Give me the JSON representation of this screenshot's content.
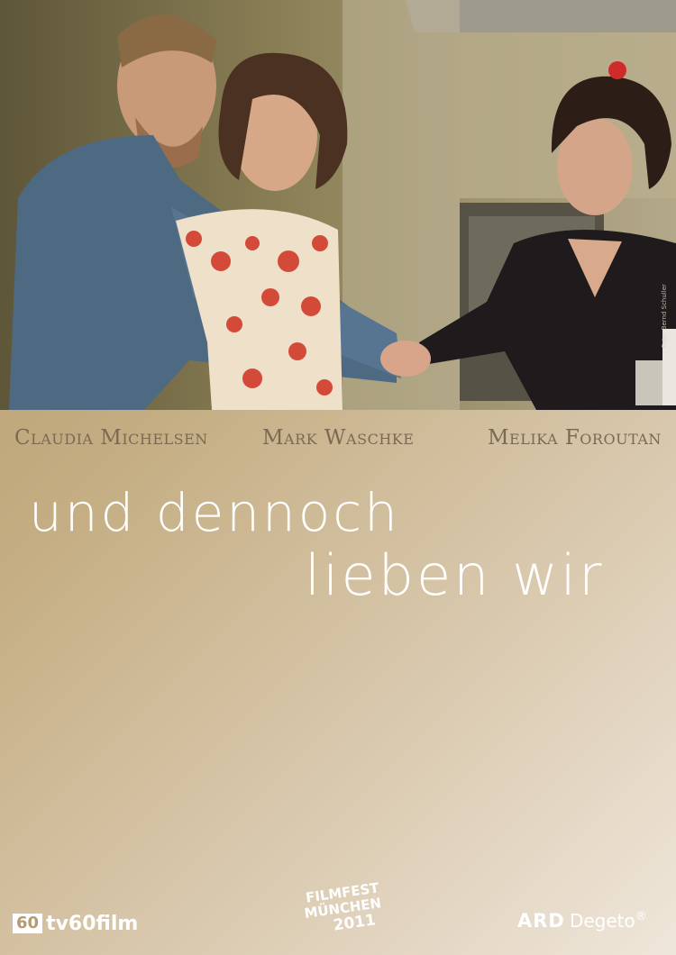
{
  "cast": {
    "actor1": "Claudia Michelsen",
    "actor2": "Mark Waschke",
    "actor3": "Melika Foroutan"
  },
  "title": {
    "line1": "und dennoch",
    "line2": "lieben wir"
  },
  "photo": {
    "credit": "Foto: Bernd Schuller"
  },
  "logos": {
    "tv60_badge": "60",
    "tv60_name": "tv60film",
    "filmfest_line1": "FILMFEST",
    "filmfest_line2": "MÜNCHEN",
    "filmfest_line3": "2011",
    "ard_1": "ARD",
    "ard_2": "Degeto",
    "ard_reg": "®"
  },
  "colors": {
    "background_start": "#b49a6c",
    "background_end": "#efe6da",
    "cast_text": "#7a6a54",
    "title_text": "#ffffff"
  }
}
